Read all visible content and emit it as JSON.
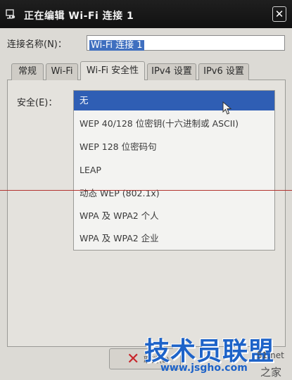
{
  "window": {
    "title": "正在编辑 Wi-Fi 连接 1",
    "close_glyph": "✕"
  },
  "connection_name": {
    "label": "连接名称(N)：",
    "value": "Wi-Fi 连接 1"
  },
  "tabs": [
    {
      "label": "常规"
    },
    {
      "label": "Wi-Fi"
    },
    {
      "label": "Wi-Fi 安全性"
    },
    {
      "label": "IPv4 设置"
    },
    {
      "label": "IPv6 设置"
    }
  ],
  "security": {
    "label": "安全(E)：",
    "options": [
      {
        "label": "无"
      },
      {
        "label": "WEP 40/128 位密钥(十六进制或 ASCII)"
      },
      {
        "label": "WEP 128 位密码句"
      },
      {
        "label": "LEAP"
      },
      {
        "label": "动态 WEP (802.1x)"
      },
      {
        "label": "WPA 及 WPA2 个人"
      },
      {
        "label": "WPA 及 WPA2 企业"
      }
    ]
  },
  "bottom_button": {
    "label": "取消(L)"
  },
  "watermark": {
    "main": "技术员联盟",
    "url": "www.jsgho.com",
    "right_top": "51.net",
    "right_bottom": "之家"
  },
  "colors": {
    "selection": "#2f5eb4",
    "watermark": "#1e63c8",
    "cancel_x": "#c8262b"
  }
}
